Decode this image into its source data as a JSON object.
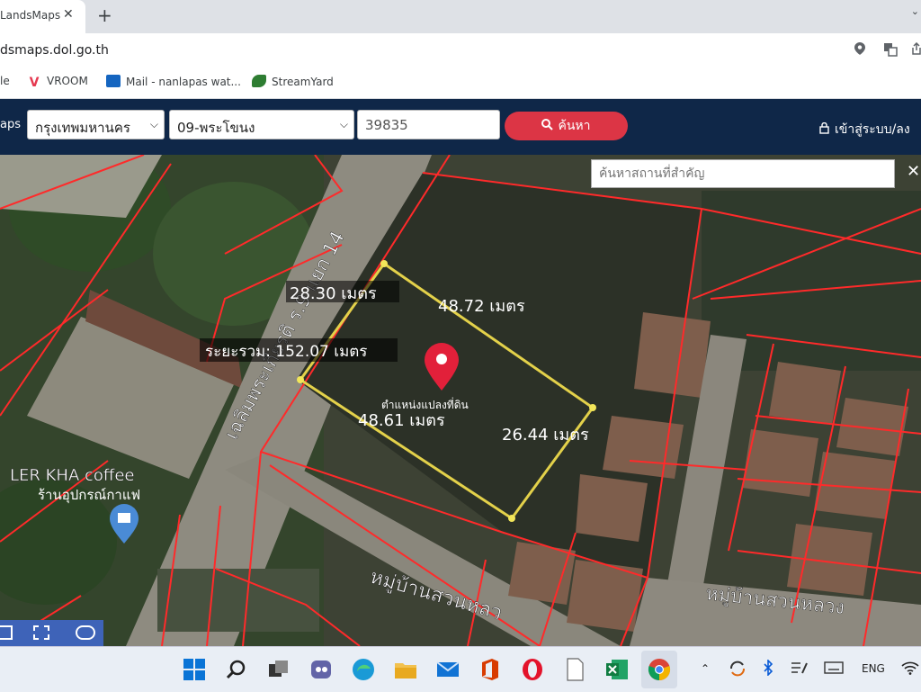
{
  "browser": {
    "tab_title": "LandsMaps",
    "tab_close": "✕",
    "new_tab": "+",
    "tab_menu": "⌄",
    "url": "dsmaps.dol.go.th",
    "bookmarks": [
      {
        "label": "le",
        "color": "#ffffff"
      },
      {
        "label": "VROOM",
        "color": "#e53950"
      },
      {
        "label": "Mail - nanlapas wat...",
        "color": "#1565c0"
      },
      {
        "label": "StreamYard",
        "color": "#2e7d32"
      }
    ]
  },
  "header": {
    "brand": "aps",
    "province": "กรุงเทพมหานคร",
    "district": "09-พระโขนง",
    "parcel_no": "39835",
    "search_label": "ค้นหา",
    "login_label": "เข้าสู่ระบบ/ลง"
  },
  "map": {
    "place_search_placeholder": "ค้นหาสถานที่สำคัญ",
    "close": "✕",
    "road_label": "เฉลิมพระเกียรติ ร.9 แยก 14",
    "distance_label": "ระยะรวม: 152.07 เมตร",
    "edges": [
      "28.30 เมตร",
      "48.72 เมตร",
      "48.61 เมตร",
      "26.44 เมตร"
    ],
    "pin_label": "ตำแหน่งแปลงที่ดิน",
    "poi_name": "LER KHA coffee",
    "poi_sub": "ร้านอุปกรณ์กาแฟ",
    "village_label_1": "หมู่บ้านสวนหลว",
    "village_label_2": "หมู่บ้านสวนหลวง",
    "colors": {
      "parcel_line": "#ff2a2a",
      "measure_line": "#e3d14a",
      "pin": "#e2203a",
      "header_bg": "#0f2748",
      "search_btn": "#dc3545"
    }
  },
  "taskbar": {
    "lang": "ENG",
    "icons": [
      "windows-icon",
      "search-icon",
      "task-view-icon",
      "teams-icon",
      "edge-icon",
      "file-explorer-icon",
      "mail-icon",
      "office-icon",
      "opera-icon",
      "notepad-icon",
      "excel-icon",
      "chrome-icon"
    ]
  }
}
